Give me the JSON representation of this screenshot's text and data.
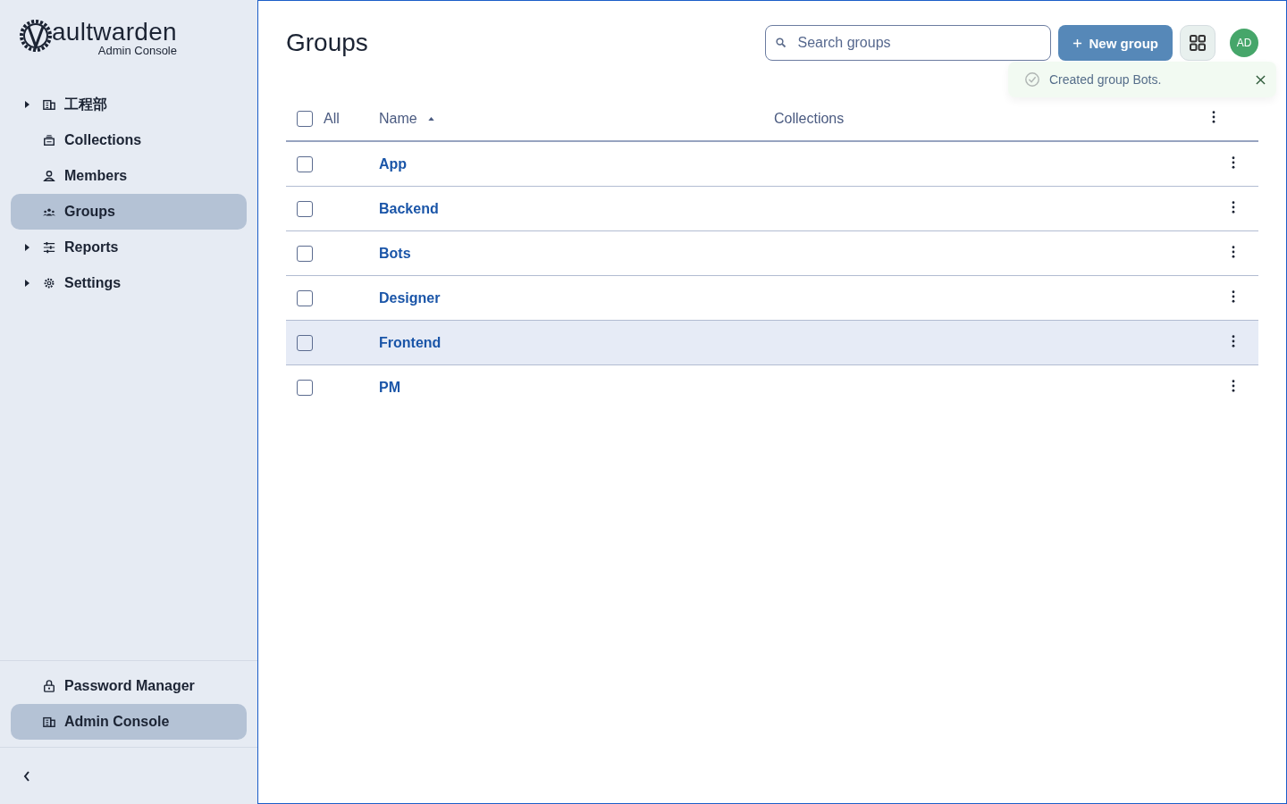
{
  "sidebar": {
    "logo": {
      "name": "aultwarden",
      "subtitle": "Admin Console"
    },
    "items": [
      {
        "label": "工程部",
        "kind": "expandable",
        "selected": false
      },
      {
        "label": "Collections",
        "kind": "link",
        "selected": false
      },
      {
        "label": "Members",
        "kind": "link",
        "selected": false
      },
      {
        "label": "Groups",
        "kind": "link",
        "selected": true
      },
      {
        "label": "Reports",
        "kind": "expandable",
        "selected": false
      },
      {
        "label": "Settings",
        "kind": "expandable",
        "selected": false
      }
    ],
    "product_items": [
      {
        "label": "Password Manager",
        "selected": false
      },
      {
        "label": "Admin Console",
        "selected": true
      }
    ]
  },
  "page": {
    "title": "Groups",
    "search": {
      "placeholder": "Search groups"
    },
    "new_button": "New group",
    "avatar": "AD",
    "toast": {
      "message": "Created group Bots."
    }
  },
  "table": {
    "select_all": {
      "label": "All",
      "checked": false
    },
    "columns": [
      {
        "label": "Name",
        "sorted": true
      },
      {
        "label": "Collections",
        "sorted": false
      }
    ],
    "rows": [
      {
        "name": "App",
        "checked": false,
        "highlighted": false
      },
      {
        "name": "Backend",
        "checked": false,
        "highlighted": false
      },
      {
        "name": "Bots",
        "checked": false,
        "highlighted": false
      },
      {
        "name": "Designer",
        "checked": false,
        "highlighted": false
      },
      {
        "name": "Frontend",
        "checked": false,
        "highlighted": true
      },
      {
        "name": "PM",
        "checked": false,
        "highlighted": false
      }
    ]
  }
}
